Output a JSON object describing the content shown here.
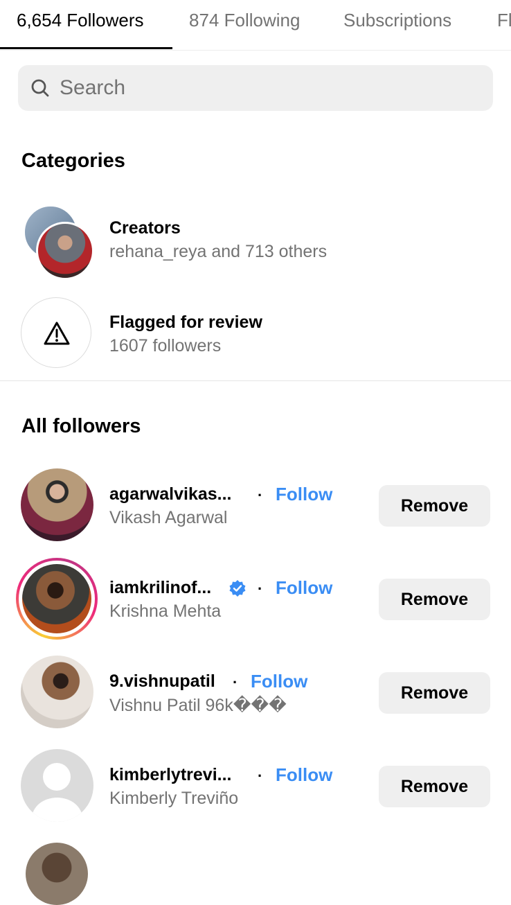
{
  "tabs": [
    {
      "label": "6,654 Followers",
      "active": true
    },
    {
      "label": "874 Following",
      "active": false
    },
    {
      "label": "Subscriptions",
      "active": false
    },
    {
      "label": "Fl",
      "active": false
    }
  ],
  "search": {
    "placeholder": "Search",
    "value": ""
  },
  "categories": {
    "heading": "Categories",
    "items": [
      {
        "title": "Creators",
        "subtitle": "rehana_reya and 713 others",
        "icon": "creator-avatars"
      },
      {
        "title": "Flagged for review",
        "subtitle": "1607 followers",
        "icon": "warning-icon"
      }
    ]
  },
  "all_followers": {
    "heading": "All followers",
    "follow_label": "Follow",
    "remove_label": "Remove",
    "items": [
      {
        "username": "agarwalvikas...",
        "full_name": "Vikash Agarwal",
        "verified": false,
        "story_ring": false
      },
      {
        "username": "iamkrilinof...",
        "full_name": "Krishna Mehta",
        "verified": true,
        "story_ring": true
      },
      {
        "username": "9.vishnupatil",
        "full_name": "Vishnu Patil 96k���",
        "verified": false,
        "story_ring": false
      },
      {
        "username": "kimberlytrevi...",
        "full_name": "Kimberly Treviño",
        "verified": false,
        "story_ring": false
      }
    ]
  },
  "colors": {
    "accent": "#3a8df4",
    "muted_text": "#737373",
    "button_bg": "#efefef"
  }
}
